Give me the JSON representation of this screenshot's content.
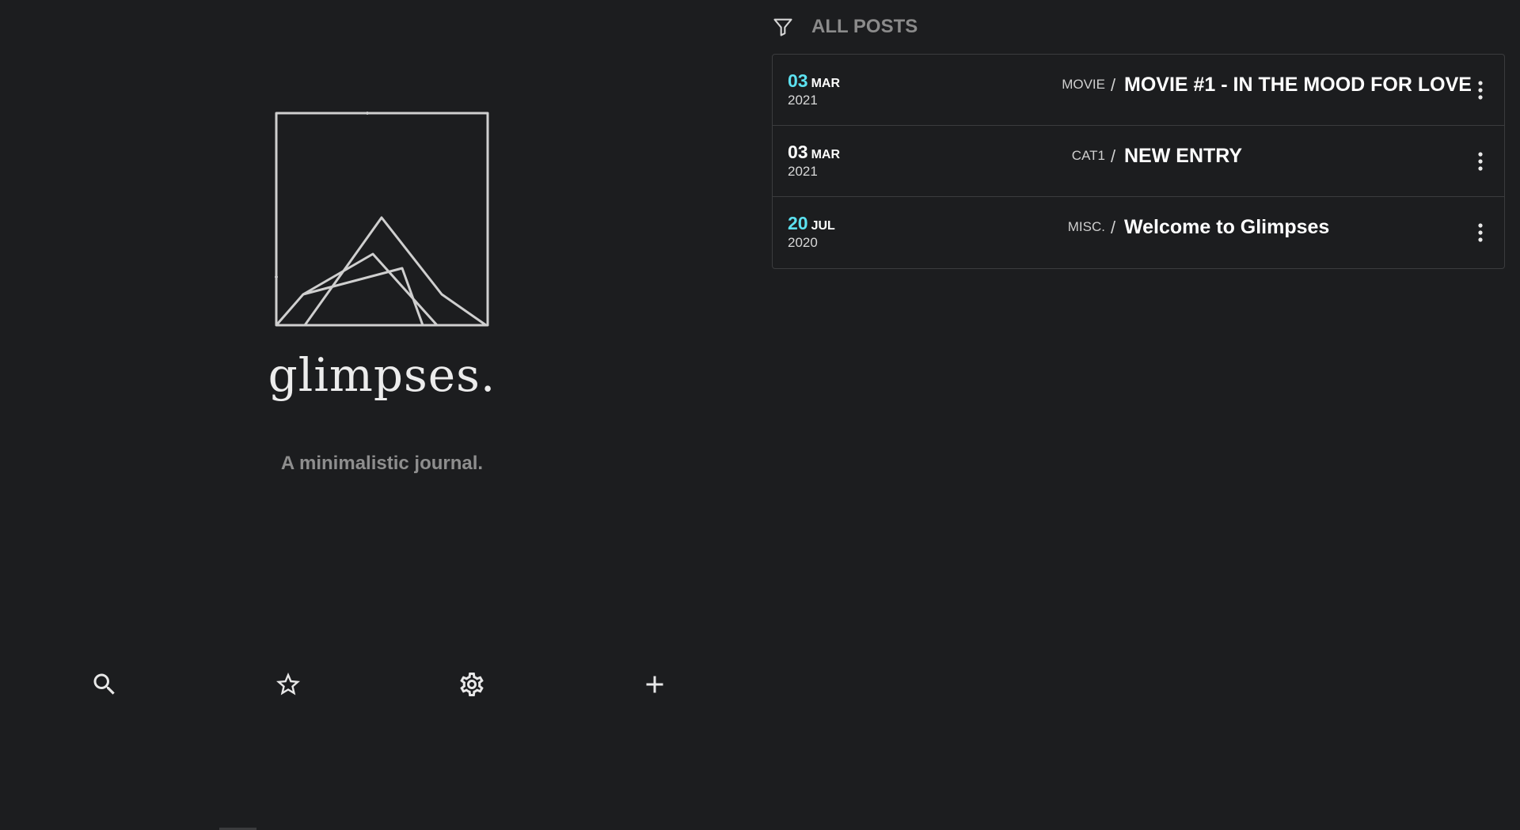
{
  "brand": {
    "name": "glimpses.",
    "tagline": "A minimalistic journal."
  },
  "toolbar": {
    "search_icon": "search-icon",
    "favorites_icon": "star-icon",
    "settings_icon": "gear-icon",
    "add_icon": "plus-icon"
  },
  "filter": {
    "icon": "filter-icon",
    "label": "ALL POSTS"
  },
  "colors": {
    "background": "#1c1d1f",
    "accent": "#5ce1f0",
    "border": "#3b3c3e"
  },
  "posts": [
    {
      "day": "03",
      "month": "MAR",
      "year": "2021",
      "day_accent": true,
      "category": "MOVIE",
      "title": "MOVIE #1 - IN THE MOOD FOR LOVE"
    },
    {
      "day": "03",
      "month": "MAR",
      "year": "2021",
      "day_accent": false,
      "category": "CAT1",
      "title": "NEW ENTRY"
    },
    {
      "day": "20",
      "month": "JUL",
      "year": "2020",
      "day_accent": true,
      "category": "MISC.",
      "title": "Welcome to Glimpses"
    }
  ]
}
